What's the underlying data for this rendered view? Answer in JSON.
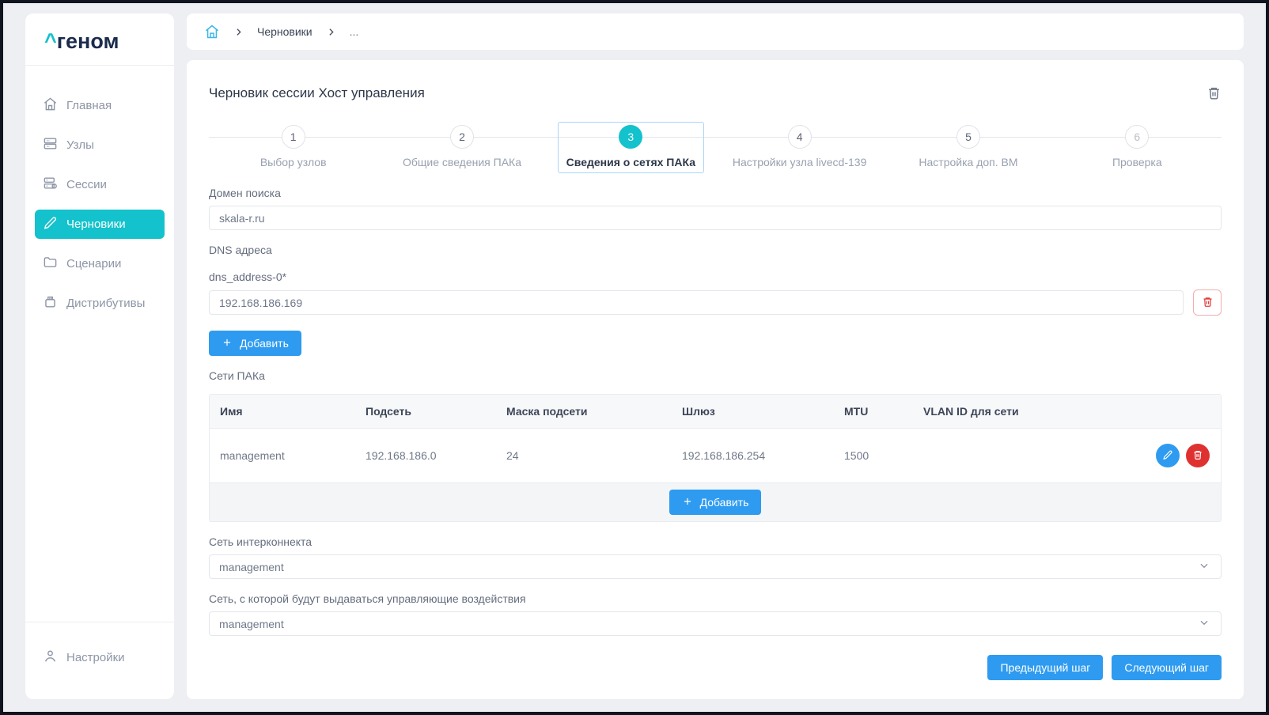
{
  "colors": {
    "accent_teal": "#13c2cc",
    "primary_blue": "#2e9bf0",
    "danger_red": "#e03131",
    "active_step_outline": "#abd6f8",
    "breadcrumb_home": "#38b8e8"
  },
  "sidebar": {
    "logo_caret": "^",
    "logo_text": "геном",
    "items": [
      {
        "label": "Главная",
        "icon": "home-icon",
        "active": false
      },
      {
        "label": "Узлы",
        "icon": "nodes-icon",
        "active": false
      },
      {
        "label": "Сессии",
        "icon": "sessions-icon",
        "active": false
      },
      {
        "label": "Черновики",
        "icon": "pencil-icon",
        "active": true
      },
      {
        "label": "Сценарии",
        "icon": "folder-icon",
        "active": false
      },
      {
        "label": "Дистрибутивы",
        "icon": "flash-drive-icon",
        "active": false
      }
    ],
    "bottom_item": {
      "label": "Настройки",
      "icon": "user-icon"
    }
  },
  "breadcrumb": {
    "home_icon": "home-icon",
    "items": [
      "Черновики",
      "..."
    ]
  },
  "page": {
    "title": "Черновик сессии Хост управления"
  },
  "stepper": {
    "steps": [
      {
        "num": "1",
        "label": "Выбор узлов",
        "state": "default"
      },
      {
        "num": "2",
        "label": "Общие сведения ПАКа",
        "state": "default"
      },
      {
        "num": "3",
        "label": "Сведения о сетях ПАКа",
        "state": "active"
      },
      {
        "num": "4",
        "label": "Настройки узла livecd-139",
        "state": "default"
      },
      {
        "num": "5",
        "label": "Настройка доп. ВМ",
        "state": "default"
      },
      {
        "num": "6",
        "label": "Проверка",
        "state": "upcoming"
      }
    ]
  },
  "form": {
    "search_domain": {
      "label": "Домен поиска",
      "value": "skala-r.ru"
    },
    "dns": {
      "section_label": "DNS адреса",
      "field_label": "dns_address-0*",
      "value": "192.168.186.169",
      "add_label": "Добавить"
    },
    "networks": {
      "label": "Сети ПАКа",
      "columns": [
        "Имя",
        "Подсеть",
        "Маска подсети",
        "Шлюз",
        "MTU",
        "VLAN ID для сети"
      ],
      "rows": [
        {
          "name": "management",
          "subnet": "192.168.186.0",
          "mask": "24",
          "gateway": "192.168.186.254",
          "mtu": "1500",
          "vlan": ""
        }
      ],
      "add_label": "Добавить"
    },
    "interconnect": {
      "label": "Сеть интерконнекта",
      "value": "management"
    },
    "control_network": {
      "label": "Сеть, с которой будут выдаваться управляющие воздействия",
      "value": "management"
    }
  },
  "wizard": {
    "prev_label": "Предыдущий шаг",
    "next_label": "Следующий шаг"
  }
}
